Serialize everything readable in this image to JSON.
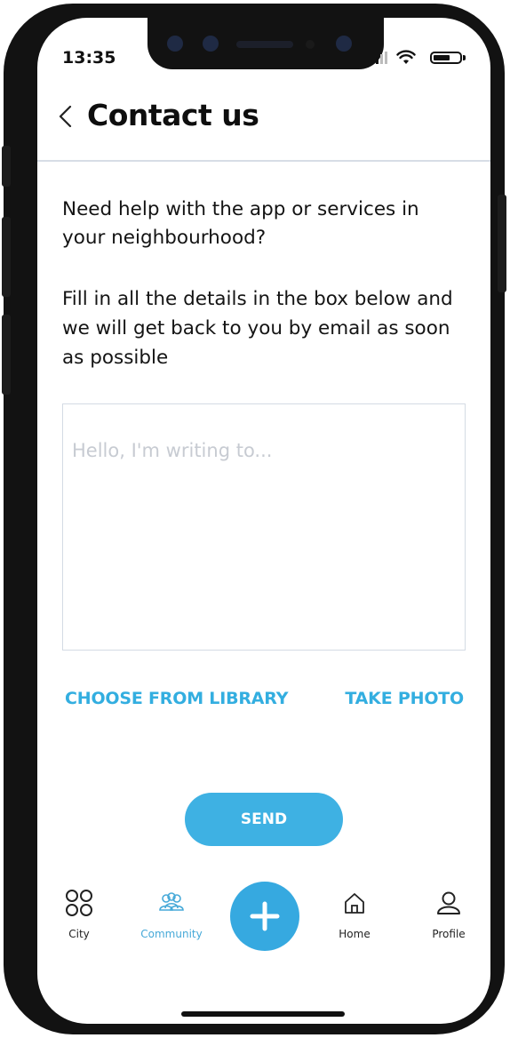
{
  "status_bar": {
    "time": "13:35"
  },
  "header": {
    "title": "Contact us"
  },
  "content": {
    "intro": "Need help with the app or services in your neighbourhood?",
    "instructions": "Fill in all the details in the box below and we will get back to you by email as soon as possible",
    "message": {
      "value": "",
      "placeholder": "Hello, I'm writing to..."
    },
    "choose_from_library": "CHOOSE FROM LIBRARY",
    "take_photo": "TAKE PHOTO",
    "send": "SEND"
  },
  "tabbar": {
    "active": "Community",
    "items": [
      {
        "label": "City",
        "icon": "grid-circles-icon"
      },
      {
        "label": "Community",
        "icon": "community-icon"
      },
      {
        "label": "",
        "icon": "plus-icon"
      },
      {
        "label": "Home",
        "icon": "home-icon"
      },
      {
        "label": "Profile",
        "icon": "profile-icon"
      }
    ]
  },
  "colors": {
    "accent": "#3eb1e3",
    "text": "#141414",
    "divider": "#d7dde6"
  }
}
